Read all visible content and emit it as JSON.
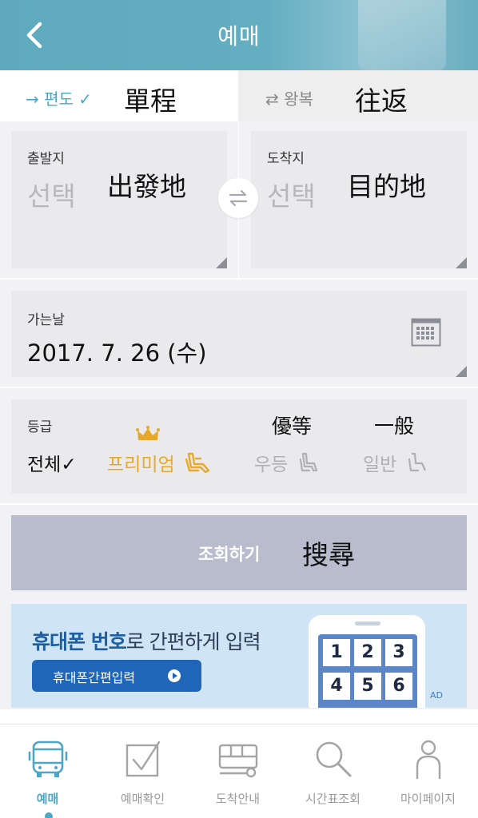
{
  "header": {
    "title": "예매"
  },
  "trip_type": {
    "one_way": {
      "label": "→ 편도 ✓",
      "annotation": "單程"
    },
    "round_trip": {
      "label": "⇄ 왕복",
      "annotation": "往返"
    }
  },
  "departure": {
    "label": "출발지",
    "value": "선택",
    "annotation": "出發地"
  },
  "arrival": {
    "label": "도착지",
    "value": "선택",
    "annotation": "目的地"
  },
  "date": {
    "label": "가는날",
    "value": "2017. 7. 26 (수)"
  },
  "grade": {
    "label": "등급",
    "options": {
      "all": "전체✓",
      "premium": "프리미엄",
      "superior": "우등",
      "general": "일반"
    },
    "annotations": {
      "superior": "優等",
      "general": "一般"
    }
  },
  "search": {
    "label": "조회하기",
    "annotation": "搜尋"
  },
  "ad": {
    "title_bold": "휴대폰 번호",
    "title_rest": "로 간편하게 입력",
    "button_label": "휴대폰간편입력",
    "keys": [
      "1",
      "2",
      "3",
      "4",
      "5",
      "6"
    ],
    "tag": "AD"
  },
  "nav": {
    "items": [
      {
        "label": "예매",
        "icon": "bus-icon"
      },
      {
        "label": "예매확인",
        "icon": "checkbox-icon"
      },
      {
        "label": "도착안내",
        "icon": "bus-side-icon"
      },
      {
        "label": "시간표조회",
        "icon": "search-icon"
      },
      {
        "label": "마이페이지",
        "icon": "person-icon"
      }
    ]
  },
  "colors": {
    "header": "#5ea9bd",
    "accent": "#4aa7c6",
    "premium": "#e8a92a",
    "search_button": "#b9bccd",
    "ad_background": "#cfe5f6"
  }
}
